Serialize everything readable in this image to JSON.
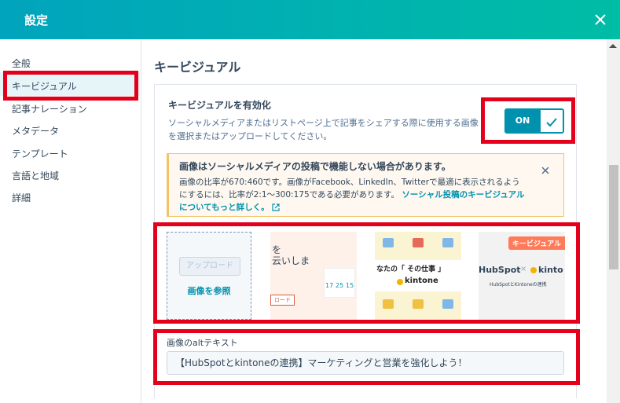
{
  "header": {
    "title": "設定"
  },
  "sidebar": {
    "items": [
      {
        "label": "全般"
      },
      {
        "label": "キービジュアル"
      },
      {
        "label": "記事ナレーション"
      },
      {
        "label": "メタデータ"
      },
      {
        "label": "テンプレート"
      },
      {
        "label": "言語と地域"
      },
      {
        "label": "詳細"
      }
    ],
    "active_index": 1
  },
  "main": {
    "section_title": "キービジュアル",
    "toggle": {
      "label": "キービジュアルを有効化",
      "description": "ソーシャルメディアまたはリストページ上で記事をシェアする際に使用する画像を選択またはアップロードしてください。",
      "state_text": "ON",
      "checked": true
    },
    "alert": {
      "title": "画像はソーシャルメディアの投稿で機能しない場合があります。",
      "body": "画像の比率が670:460です。画像がFacebook、LinkedIn、Twitterで最適に表示されるようにするには、比率が2:1～300:175である必要があります。",
      "link": "ソーシャル投稿のキービジュアルについてもっと詳しく。"
    },
    "upload": {
      "button": "アップロード",
      "browse": "画像を参照"
    },
    "thumbnails": [
      {
        "line1": "を",
        "line2": "云いしま",
        "dates": [
          "17",
          "25",
          "15"
        ],
        "cta": "ロード"
      },
      {
        "text": "なたの「 その仕事 」",
        "logo": "kintone"
      },
      {
        "badge": "キービジュアル",
        "logo_left": "HubSpot",
        "logo_right": "kinto",
        "caption": "HubSpotとKintoneの連携"
      }
    ],
    "alt_text": {
      "label": "画像のaltテキスト",
      "value": "【HubSpotとkintoneの連携】マーケティングと営業を強化しよう！"
    }
  },
  "colors": {
    "accent": "#0091ae",
    "header_gradient_start": "#00a4bd",
    "header_gradient_end": "#00bda5",
    "highlight_red": "#e4001b"
  }
}
